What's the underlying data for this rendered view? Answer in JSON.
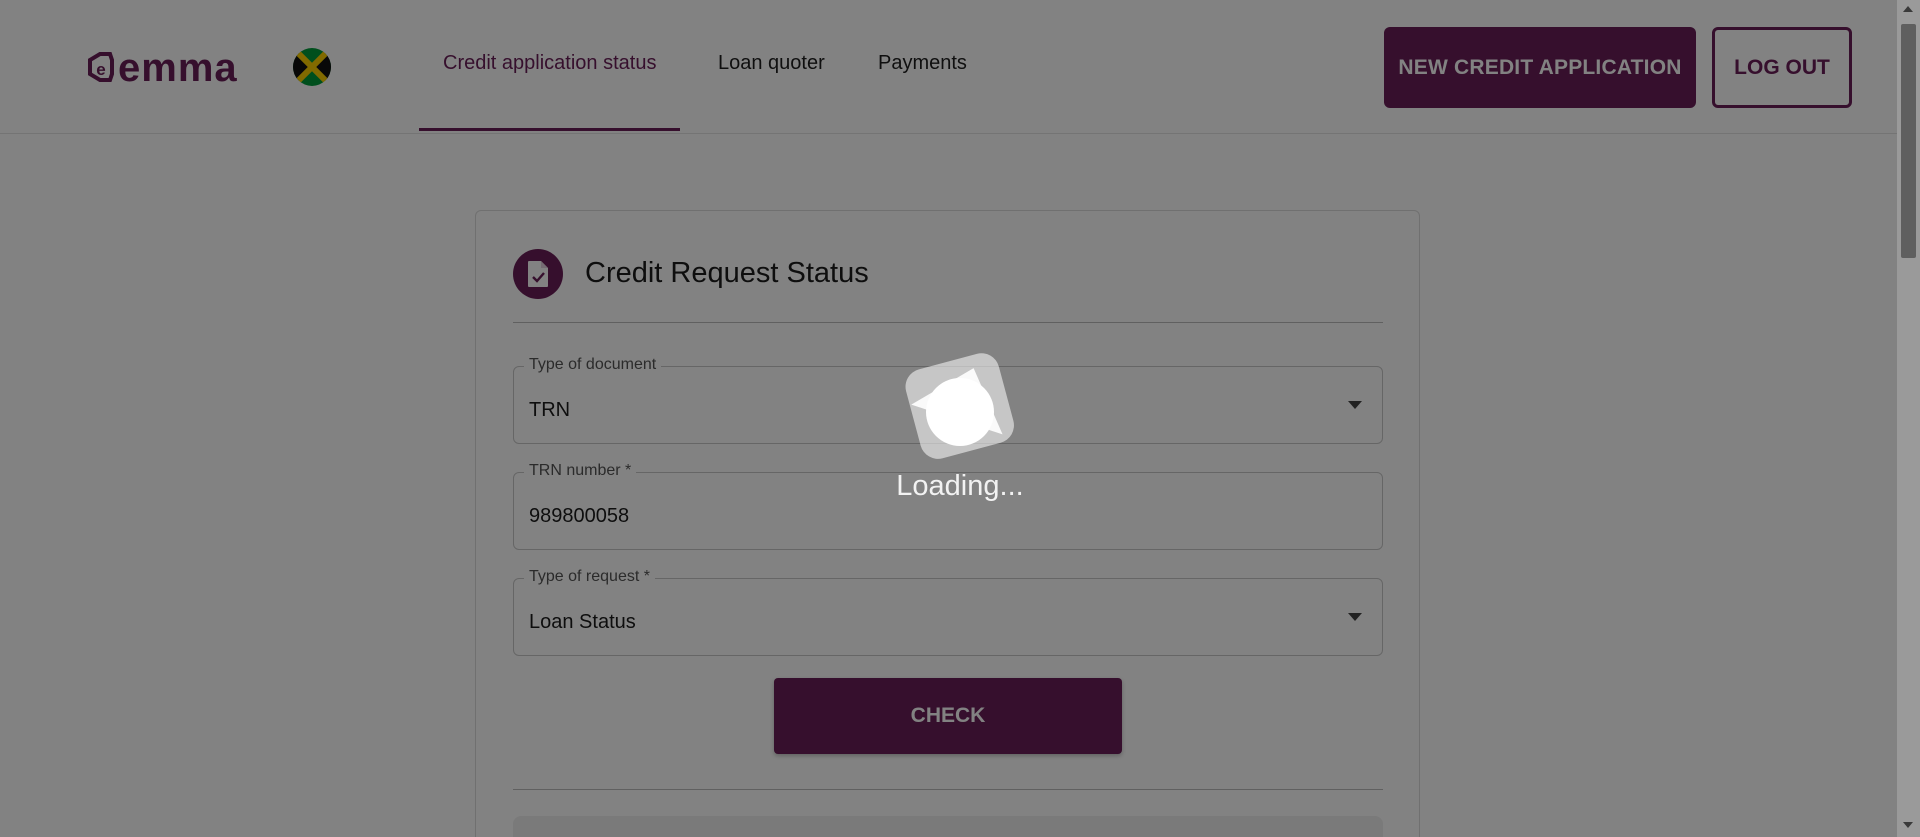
{
  "header": {
    "logo_text": "emma",
    "flag_icon": "jamaica-flag-icon",
    "nav_tabs": [
      {
        "label": "Credit application status",
        "active": true
      },
      {
        "label": "Loan quoter",
        "active": false
      },
      {
        "label": "Payments",
        "active": false
      }
    ],
    "new_application_label": "NEW CREDIT APPLICATION",
    "logout_label": "LOG OUT"
  },
  "card": {
    "icon": "document-check-icon",
    "title": "Credit Request Status",
    "fields": {
      "document_type": {
        "label": "Type of document",
        "value": "TRN"
      },
      "trn_number": {
        "label": "TRN number *",
        "value": "989800058"
      },
      "request_type": {
        "label": "Type of request *",
        "value": "Loan Status"
      }
    },
    "check_label": "CHECK"
  },
  "overlay": {
    "loading_text": "Loading..."
  },
  "colors": {
    "brand": "#6b1f58",
    "overlay": "rgba(0,0,0,0.49)"
  }
}
